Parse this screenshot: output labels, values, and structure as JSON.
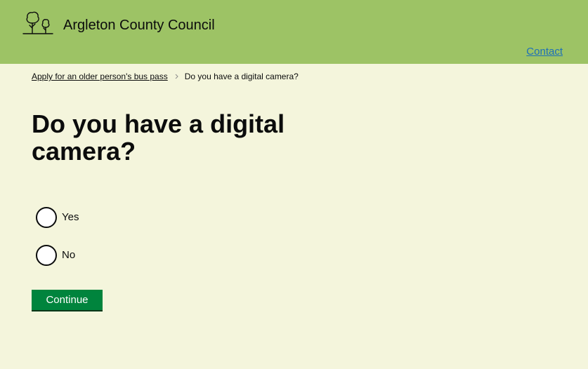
{
  "header": {
    "site_name": "Argleton County Council",
    "contact_link": "Contact",
    "logo_icon": "trees-icon"
  },
  "breadcrumb": {
    "parent_label": "Apply for an older person's bus pass",
    "separator_icon": "chevron-right-icon",
    "current_label": "Do you have a digital camera?"
  },
  "page": {
    "title": "Do you have a digital camera?"
  },
  "question": {
    "options": [
      {
        "label": "Yes",
        "selected": false
      },
      {
        "label": "No",
        "selected": false
      }
    ]
  },
  "actions": {
    "continue_label": "Continue"
  },
  "colors": {
    "header_bg": "#9dc365",
    "page_bg": "#f4f5dc",
    "button_bg": "#00843d",
    "link": "#1d70b8",
    "text": "#0b0c0c"
  }
}
